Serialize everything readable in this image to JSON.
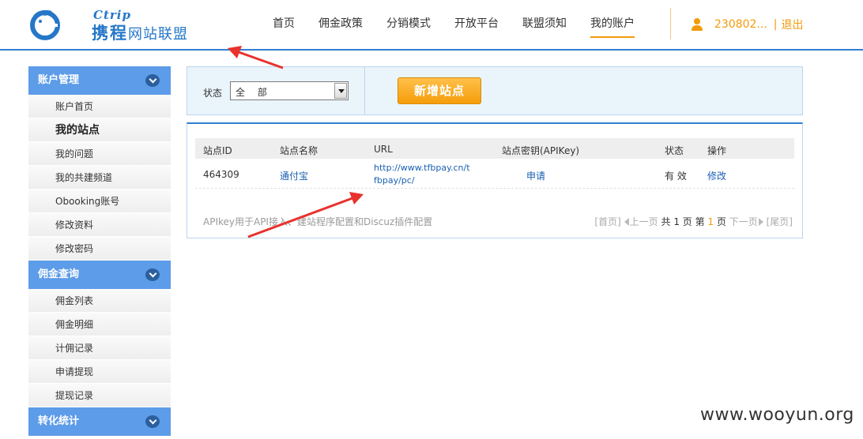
{
  "header": {
    "logo_en": "Ctrip",
    "logo_cn": "携程",
    "logo_sub": "网站联盟",
    "nav": [
      "首页",
      "佣金政策",
      "分销模式",
      "开放平台",
      "联盟须知",
      "我的账户"
    ],
    "active_nav": "我的账户",
    "username": "230802...",
    "logout": "退出",
    "accent_color": "#f39b0a",
    "brand_color": "#2577c8"
  },
  "sidebar": {
    "groups": [
      {
        "title": "账户管理",
        "items": [
          "账户首页",
          "我的站点",
          "我的问题",
          "我的共建频道",
          "Obooking账号",
          "修改资料",
          "修改密码"
        ]
      },
      {
        "title": "佣金查询",
        "items": [
          "佣金列表",
          "佣金明细",
          "计佣记录",
          "申请提现",
          "提现记录"
        ]
      },
      {
        "title": "转化统计",
        "items": []
      }
    ],
    "current_item": "我的站点"
  },
  "filter": {
    "label": "状态",
    "select_value": "全 部",
    "add_button": "新增站点"
  },
  "table": {
    "headers": [
      "站点ID",
      "站点名称",
      "URL",
      "站点密钥(APIKey)",
      "状态",
      "操作"
    ],
    "rows": [
      {
        "id": "464309",
        "name": "通付宝",
        "url": "http://www.tfbpay.cn/tfbpay/pc/",
        "apikey": "申请",
        "status": "有 效",
        "action": "修改"
      }
    ],
    "note": "APIkey用于API接入、建站程序配置和Discuz插件配置"
  },
  "pager": {
    "first": "[首页]",
    "prev": "上一页",
    "total_prefix": "共",
    "total": "1",
    "page_unit": "页",
    "page_prefix": "第",
    "current": "1",
    "next": "下一页",
    "last": "[尾页]"
  },
  "watermark": "www.wooyun.org"
}
